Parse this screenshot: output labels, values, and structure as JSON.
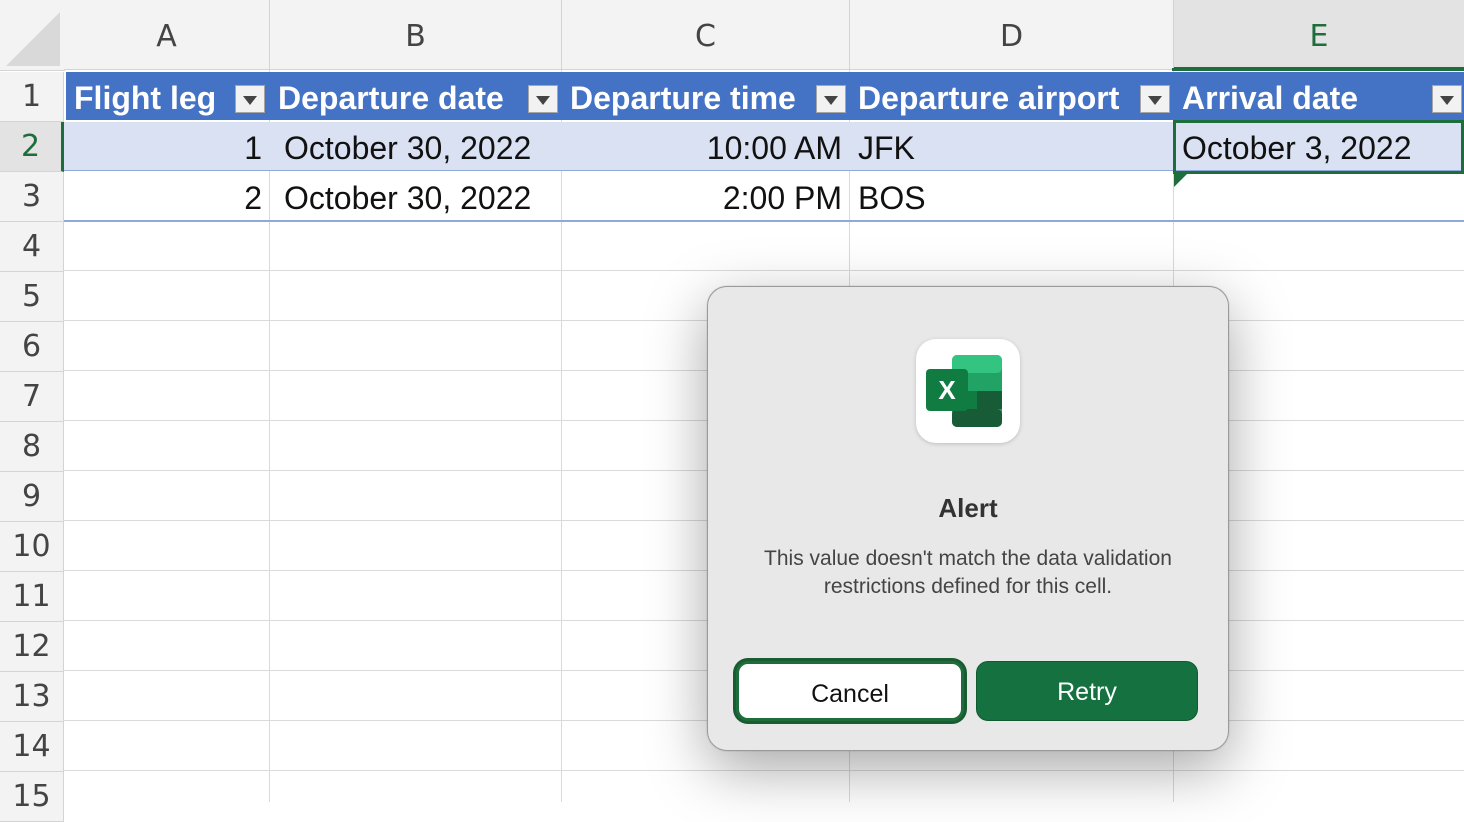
{
  "columns": [
    "A",
    "B",
    "C",
    "D",
    "E"
  ],
  "rows": [
    "1",
    "2",
    "3",
    "4",
    "5",
    "6",
    "7",
    "8",
    "9",
    "10",
    "11",
    "12",
    "13",
    "14",
    "15"
  ],
  "table": {
    "headers": [
      "Flight leg",
      "Departure date",
      "Departure time",
      "Departure airport",
      "Arrival date"
    ],
    "data": [
      [
        "1",
        "October 30, 2022",
        "10:00 AM",
        "JFK",
        "October 3, 2022"
      ],
      [
        "2",
        "October 30, 2022",
        "2:00 PM",
        "BOS",
        ""
      ]
    ]
  },
  "colors": {
    "table_header": "#4472c4",
    "band_row": "#d9e1f2",
    "excel_green": "#1e6e3c"
  },
  "dialog": {
    "icon": "excel-app-icon",
    "icon_letter": "X",
    "title": "Alert",
    "message": "This value doesn't match the data validation restrictions defined for this cell.",
    "cancel_label": "Cancel",
    "retry_label": "Retry"
  }
}
